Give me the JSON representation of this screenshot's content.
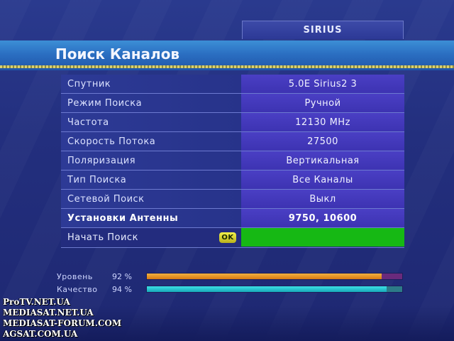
{
  "header": {
    "satellite_tab": "SIRIUS",
    "title": "Поиск Каналов"
  },
  "menu": {
    "rows": [
      {
        "label": "Спутник",
        "value": "5.0E Sirius2 3"
      },
      {
        "label": "Режим Поиска",
        "value": "Ручной"
      },
      {
        "label": "Частота",
        "value": "12130 MHz"
      },
      {
        "label": "Скорость Потока",
        "value": "27500"
      },
      {
        "label": "Поляризация",
        "value": "Вертикальная"
      },
      {
        "label": "Тип Поиска",
        "value": "Все Каналы"
      },
      {
        "label": "Сетевой Поиск",
        "value": "Выкл"
      },
      {
        "label": "Установки Антенны",
        "value": "9750, 10600"
      }
    ],
    "start": {
      "label": "Начать Поиск",
      "ok_badge": "OK"
    }
  },
  "signal": {
    "level": {
      "label": "Уровень",
      "value_text": "92 %",
      "percent": 92
    },
    "quality": {
      "label": "Качество",
      "value_text": "94 %",
      "percent": 94
    }
  },
  "watermark": {
    "lines": [
      "ProTV.NET.UA",
      "MEDIASAT.NET.UA",
      "MEDIASAT-FORUM.COM",
      "AGSAT.COM.UA"
    ]
  },
  "colors": {
    "background": "#232f7e",
    "title_bar": "#2b6fc2",
    "value_cell": "#4a3fc4",
    "start_highlight": "#16b814",
    "level_bar": "#e08a1c",
    "quality_bar": "#2ad0dc"
  }
}
